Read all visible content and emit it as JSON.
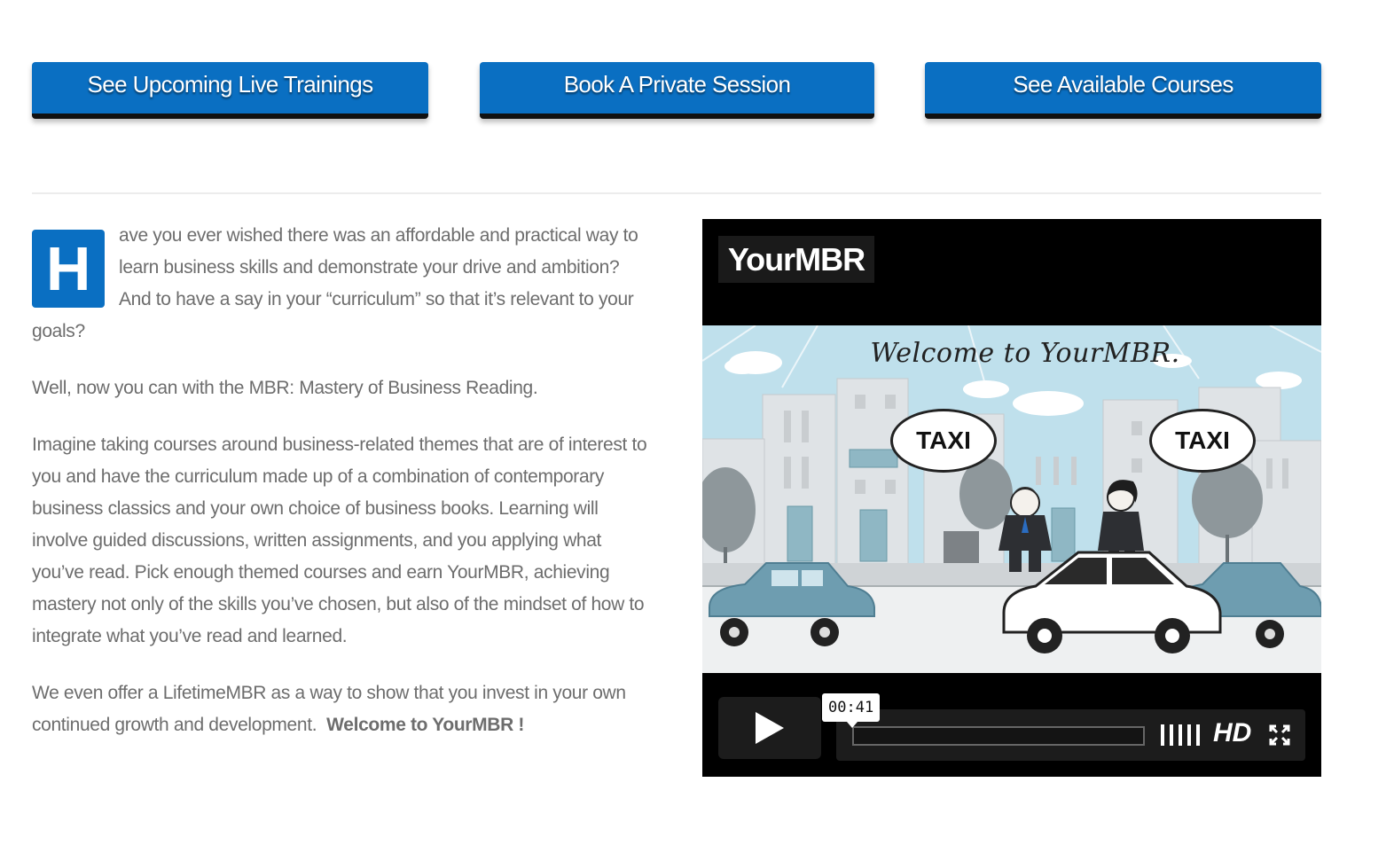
{
  "buttons": [
    {
      "label": "See Upcoming Live Trainings"
    },
    {
      "label": "Book A Private Session"
    },
    {
      "label": "See Available Courses"
    }
  ],
  "intro": {
    "dropcap": "H",
    "p1": "ave you ever wished there was an affordable and practical way to learn business skills and demonstrate your drive and ambition? And to have a say in your “curriculum” so that it’s relevant to your goals?",
    "p2": "Well, now you can with the MBR: Mastery of Business Reading.",
    "p3": "Imagine taking courses around business-related themes that are of interest to you and have the curriculum made up of a combination of contemporary business classics and your own choice of business books. Learning will involve guided discussions, written assignments, and you applying what you’ve read. Pick enough themed courses and earn YourMBR, achieving mastery not only of the skills you’ve chosen, but also of the mindset of how to integrate what you’ve read and learned.",
    "p4_text": "We even offer a LifetimeMBR as a way to show that you invest in your own continued growth and development.",
    "p4_bold": "Welcome to YourMBR !"
  },
  "video": {
    "logo": "YourMBR",
    "scene_title": "Welcome to YourMBR.",
    "bubble_left": "TAXI",
    "bubble_right": "TAXI",
    "time": "00:41",
    "hd_label": "HD",
    "progress": 0
  },
  "colors": {
    "accent": "#0a6fc2",
    "text": "#6d6d6d"
  }
}
